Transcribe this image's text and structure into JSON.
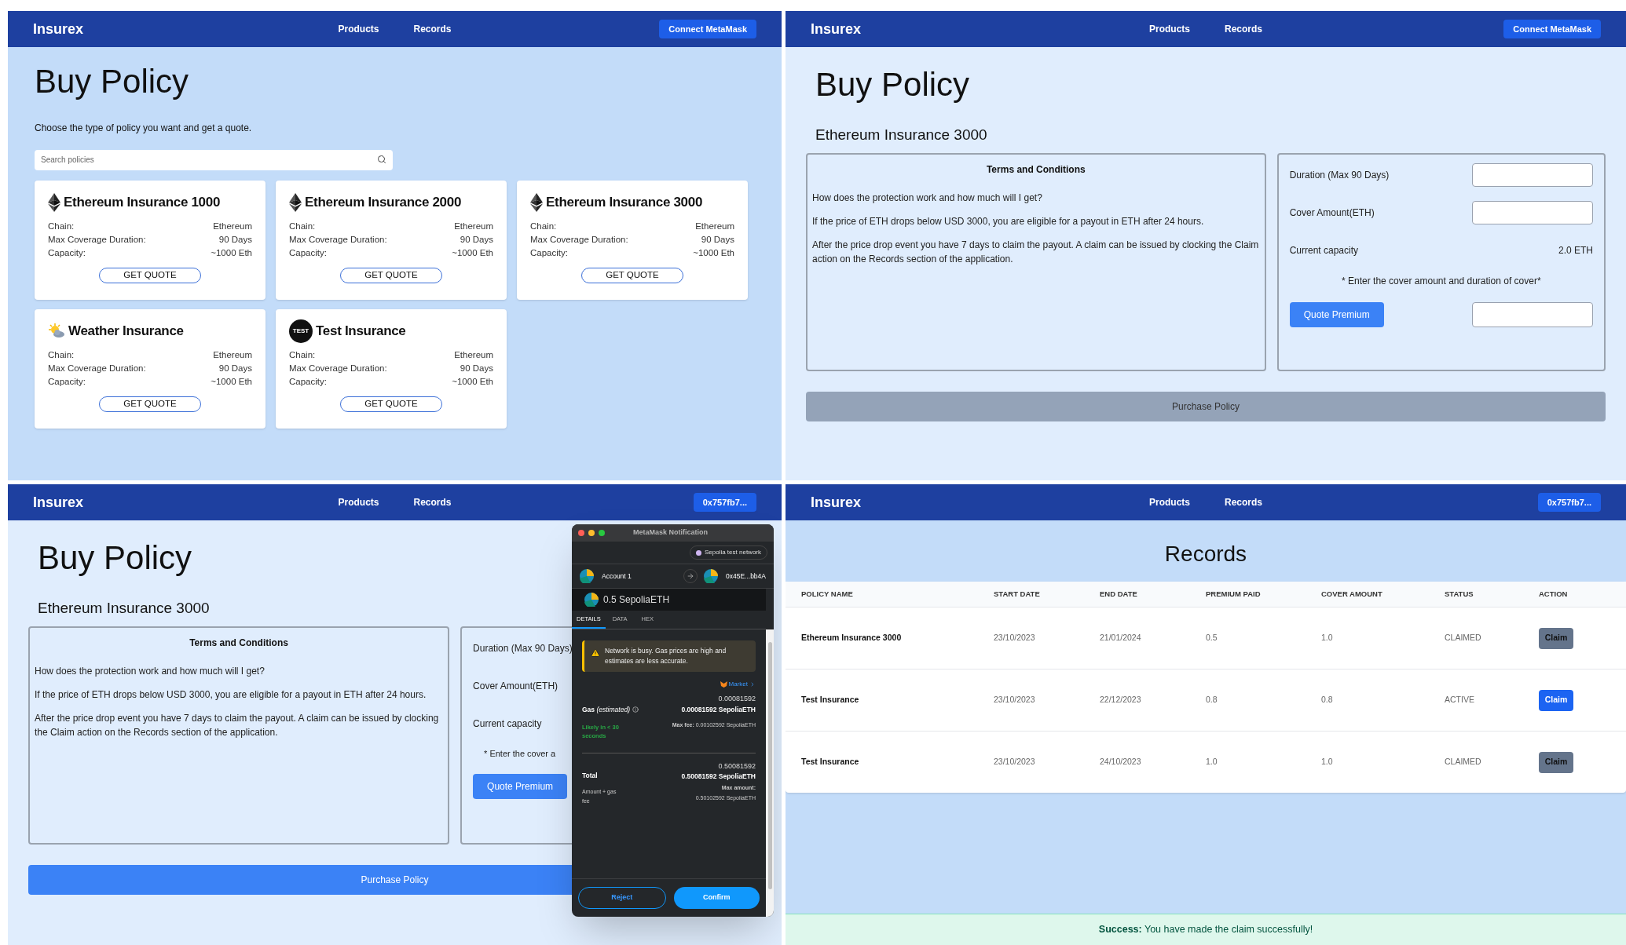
{
  "panels": [
    {
      "kind": "catalog",
      "navbar": {
        "brand": "Insurex",
        "links": [
          "Products",
          "Records"
        ],
        "wallet_button": "Connect MetaMask"
      },
      "title": "Buy Policy",
      "subtitle": "Choose the type of policy you want and get a quote.",
      "search": {
        "placeholder": "Search policies"
      },
      "products": [
        {
          "kind": "ethereum",
          "name": "Ethereum Insurance 1000",
          "details": [
            {
              "label": "Chain:",
              "value": "Ethereum"
            },
            {
              "label": "Max Coverage Duration:",
              "value": "90 Days"
            },
            {
              "label": "Capacity:",
              "value": "~1000 Eth"
            }
          ],
          "button": "GET QUOTE"
        },
        {
          "kind": "ethereum",
          "name": "Ethereum Insurance 2000",
          "details": [
            {
              "label": "Chain:",
              "value": "Ethereum"
            },
            {
              "label": "Max Coverage Duration:",
              "value": "90 Days"
            },
            {
              "label": "Capacity:",
              "value": "~1000 Eth"
            }
          ],
          "button": "GET QUOTE"
        },
        {
          "kind": "ethereum",
          "name": "Ethereum Insurance 3000",
          "details": [
            {
              "label": "Chain:",
              "value": "Ethereum"
            },
            {
              "label": "Max Coverage Duration:",
              "value": "90 Days"
            },
            {
              "label": "Capacity:",
              "value": "~1000 Eth"
            }
          ],
          "button": "GET QUOTE"
        },
        {
          "kind": "weather",
          "name": "Weather Insurance",
          "details": [
            {
              "label": "Chain:",
              "value": "Ethereum"
            },
            {
              "label": "Max Coverage Duration:",
              "value": "90 Days"
            },
            {
              "label": "Capacity:",
              "value": "~1000 Eth"
            }
          ],
          "button": "GET QUOTE"
        },
        {
          "kind": "test",
          "icon_text": "TEST",
          "name": "Test Insurance",
          "details": [
            {
              "label": "Chain:",
              "value": "Ethereum"
            },
            {
              "label": "Max Coverage Duration:",
              "value": "90 Days"
            },
            {
              "label": "Capacity:",
              "value": "~1000 Eth"
            }
          ],
          "button": "GET QUOTE"
        }
      ]
    },
    {
      "kind": "quote",
      "navbar": {
        "brand": "Insurex",
        "links": [
          "Products",
          "Records"
        ],
        "wallet_button": "Connect MetaMask"
      },
      "title": "Buy Policy",
      "product": "Ethereum Insurance 3000",
      "terms": {
        "heading": "Terms and Conditions",
        "paragraphs": [
          "How does the protection work and how much will I get?",
          "If the price of ETH drops below USD 3000, you are eligible for a payout in ETH after 24 hours.",
          "After the price drop event you have 7 days to claim the payout. A claim can be issued by clocking the Claim action on the Records section of the application."
        ]
      },
      "form": {
        "rows": [
          {
            "kind": "input",
            "label": "Duration (Max 90 Days)"
          },
          {
            "kind": "input",
            "label": "Cover Amount(ETH)"
          },
          {
            "kind": "value",
            "label": "Current capacity",
            "value": "2.0 ETH"
          }
        ],
        "note": "* Enter the cover amount and duration of cover*",
        "quote_button": "Quote Premium",
        "result_field": true
      },
      "purchase": {
        "label": "Purchase Policy",
        "enabled": false
      }
    },
    {
      "kind": "quote",
      "navbar": {
        "brand": "Insurex",
        "links": [
          "Products",
          "Records"
        ],
        "wallet_button": "0x757fb7..."
      },
      "title": "Buy Policy",
      "product": "Ethereum Insurance 3000",
      "terms": {
        "heading": "Terms and Conditions",
        "paragraphs": [
          "How does the protection work and how much will I get?",
          "If the price of ETH drops below USD 3000, you are eligible for a payout in ETH after 24 hours.",
          "After the price drop event you have 7 days to claim the payout. A claim can be issued by clocking the Claim action on the Records section of the application."
        ]
      },
      "form": {
        "rows": [
          {
            "kind": "label",
            "label": "Duration (Max 90 Days)"
          },
          {
            "kind": "label",
            "label": "Cover Amount(ETH)"
          },
          {
            "kind": "label",
            "label": "Current capacity"
          }
        ],
        "note": "* Enter the cover a",
        "quote_button": "Quote Premium"
      },
      "purchase": {
        "label": "Purchase Policy",
        "enabled": true
      },
      "wallet_popup": {
        "title": "MetaMask Notification",
        "network": "Sepolia test network",
        "from": "Account 1",
        "to": "0x45E...bb4A",
        "amount": "0.5 SepoliaETH",
        "tabs": [
          {
            "label": "DETAILS",
            "selected": true
          },
          {
            "label": "DATA",
            "selected": false
          },
          {
            "label": "HEX",
            "selected": false
          }
        ],
        "warning": "Network is busy. Gas prices are high and estimates are less accurate.",
        "market_link": "Market",
        "gas": {
          "label": "**Gas** *(estimated)*",
          "value": "0.00081592",
          "value_bold": "0.00081592 SepoliaETH",
          "speed": "Likely in < 30 seconds",
          "max_fee": "**Max fee:** 0.00102592 SepoliaETH"
        },
        "total": {
          "label": "Total",
          "value": "0.50081592",
          "value_bold": "0.50081592 SepoliaETH",
          "caption": "Amount + gas fee",
          "max_amount_label": "Max amount:",
          "max_amount": "0.50102592 SepoliaETH"
        },
        "reject": "Reject",
        "confirm": "Confirm"
      }
    },
    {
      "kind": "records",
      "navbar": {
        "brand": "Insurex",
        "links": [
          "Products",
          "Records"
        ],
        "wallet_button": "0x757fb7..."
      },
      "title": "Records",
      "table": {
        "columns": [
          "POLICY NAME",
          "START DATE",
          "END DATE",
          "PREMIUM PAID",
          "COVER AMOUNT",
          "STATUS",
          "ACTION"
        ],
        "rows": [
          {
            "cells": [
              "Ethereum Insurance 3000",
              "23/10/2023",
              "21/01/2024",
              "0.5",
              "1.0",
              "CLAIMED"
            ],
            "action": {
              "label": "Claim",
              "enabled": false
            }
          },
          {
            "cells": [
              "Test Insurance",
              "23/10/2023",
              "22/12/2023",
              "0.8",
              "0.8",
              "ACTIVE"
            ],
            "action": {
              "label": "Claim",
              "enabled": true
            }
          },
          {
            "cells": [
              "Test Insurance",
              "23/10/2023",
              "24/10/2023",
              "1.0",
              "1.0",
              "CLAIMED"
            ],
            "action": {
              "label": "Claim",
              "enabled": false
            }
          }
        ]
      },
      "alert": {
        "kind": "success",
        "message": "**Success:** You have made the claim successfully!"
      }
    }
  ]
}
